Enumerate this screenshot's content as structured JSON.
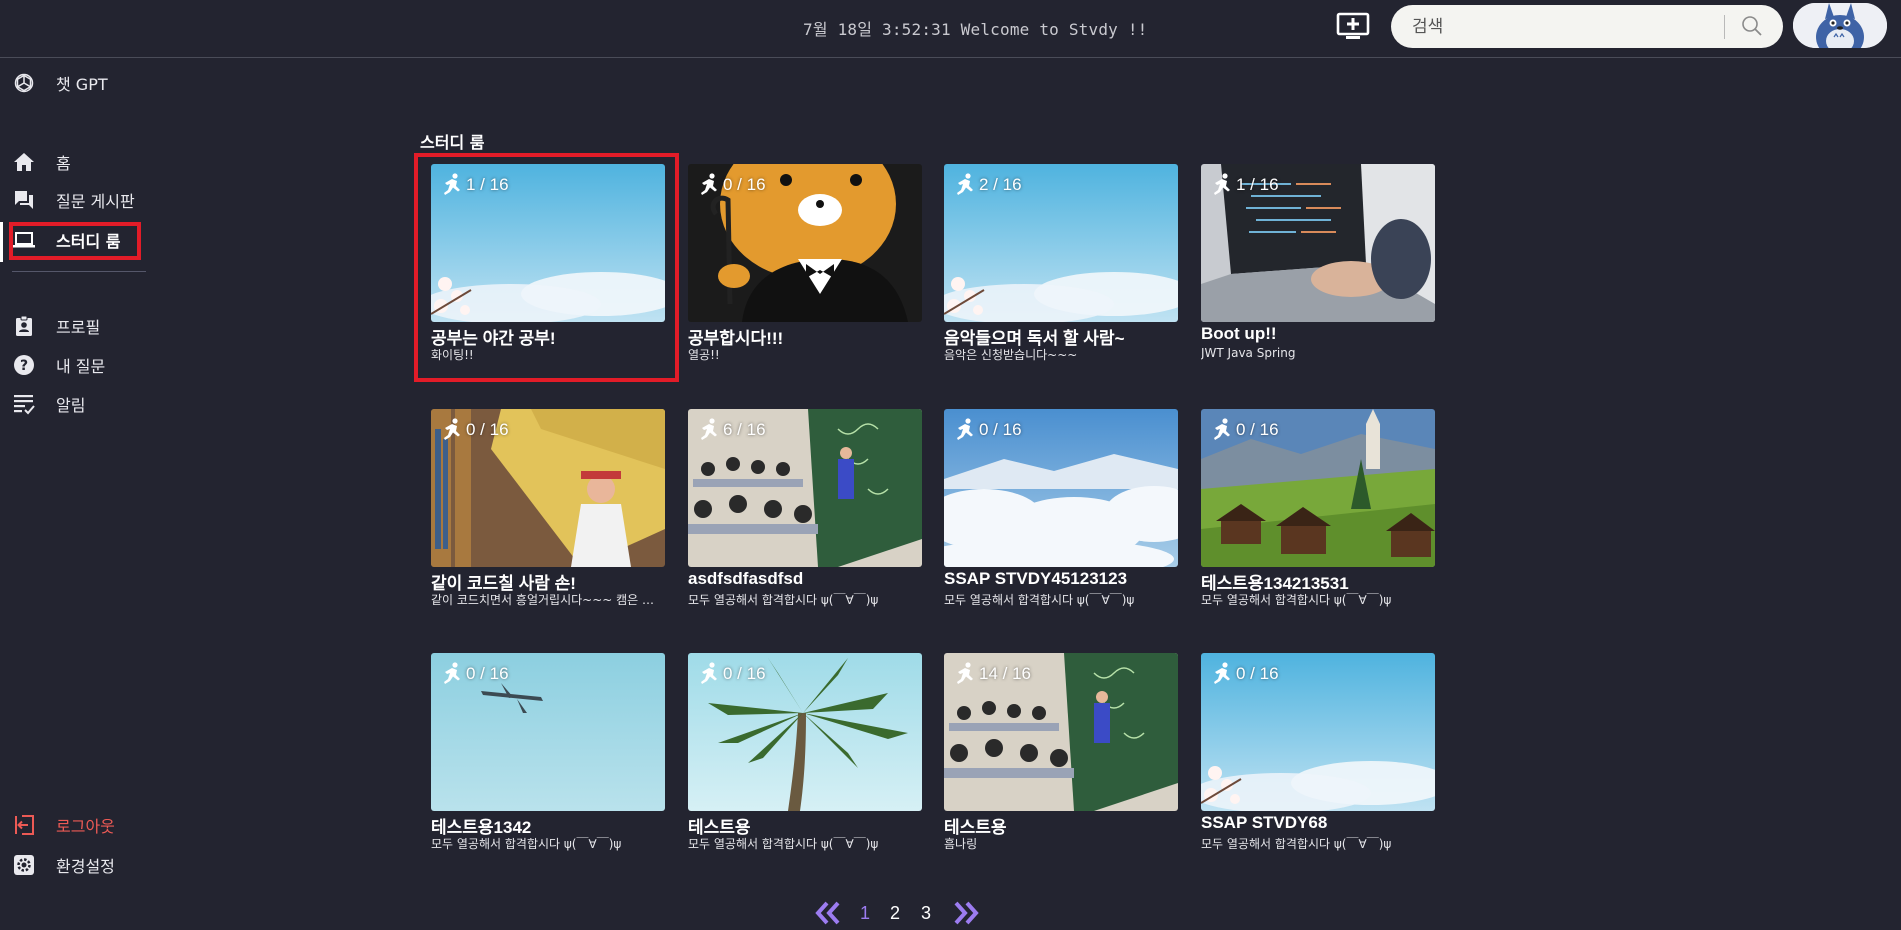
{
  "header": {
    "clock_text": "7월 18일 3:52:31 Welcome to Stvdy !!",
    "search": {
      "placeholder": "검색"
    },
    "icons": {
      "add": "add-screen-icon",
      "search": "search-icon",
      "avatar": "avatar"
    }
  },
  "sidebar": {
    "chatgpt": {
      "label": "챗 GPT",
      "icon": "openai-icon"
    },
    "nav": [
      {
        "label": "홈",
        "icon": "home-icon"
      },
      {
        "label": "질문 게시판",
        "icon": "forum-icon"
      },
      {
        "label": "스터디 룸",
        "icon": "laptop-icon",
        "active": true
      }
    ],
    "personal": [
      {
        "label": "프로필",
        "icon": "profile-icon"
      },
      {
        "label": "내 질문",
        "icon": "help-icon"
      },
      {
        "label": "알림",
        "icon": "notification-list-icon"
      }
    ],
    "bottom": [
      {
        "label": "로그아웃",
        "icon": "logout-icon",
        "color": "#ec5a55"
      },
      {
        "label": "환경설정",
        "icon": "settings-icon"
      }
    ]
  },
  "main": {
    "section_title": "스터디 룸",
    "rooms": [
      {
        "occupancy": "1 / 16",
        "title": "공부는 야간 공부!",
        "desc": "화이팅!!",
        "thumb": "sky-blossom",
        "highlighted": true
      },
      {
        "occupancy": "0 / 16",
        "title": "공부합시다!!!",
        "desc": "열공!!",
        "thumb": "ryan"
      },
      {
        "occupancy": "2 / 16",
        "title": "음악들으며 독서 할 사람~",
        "desc": "음악은 신청받습니다~~~",
        "thumb": "sky-blossom"
      },
      {
        "occupancy": "1 / 16",
        "title": "Boot up!!",
        "desc": "JWT Java Spring",
        "thumb": "laptop"
      },
      {
        "occupancy": "0 / 16",
        "title": "같이 코드칠 사람 손!",
        "desc": "같이 코드치면서 흥얼거립시다~~~ 캠은 필수!",
        "thumb": "bookstore"
      },
      {
        "occupancy": "6 / 16",
        "title": "asdfsdfasdfsd",
        "desc": "모두 열공해서 합격합시다 ψ(￣∀￣)ψ",
        "thumb": "lecture"
      },
      {
        "occupancy": "0 / 16",
        "title": "SSAP STVDY45123123",
        "desc": "모두 열공해서 합격합시다 ψ(￣∀￣)ψ",
        "thumb": "clouds"
      },
      {
        "occupancy": "0 / 16",
        "title": "테스트용134213531",
        "desc": "모두 열공해서 합격합시다 ψ(￣∀￣)ψ",
        "thumb": "alps"
      },
      {
        "occupancy": "0 / 16",
        "title": "테스트용1342",
        "desc": "모두 열공해서 합격합시다 ψ(￣∀￣)ψ",
        "thumb": "plane"
      },
      {
        "occupancy": "0 / 16",
        "title": "테스트용",
        "desc": "모두 열공해서 합격합시다 ψ(￣∀￣)ψ",
        "thumb": "palm"
      },
      {
        "occupancy": "14 / 16",
        "title": "테스트용",
        "desc": "흠나링",
        "thumb": "lecture"
      },
      {
        "occupancy": "0 / 16",
        "title": "SSAP STVDY68",
        "desc": "모두 열공해서 합격합시다 ψ(￣∀￣)ψ",
        "thumb": "sky-blossom"
      }
    ]
  },
  "pagination": {
    "pages": [
      "1",
      "2",
      "3"
    ],
    "current": "1",
    "accent": "#9c7cf0",
    "icons": {
      "prev": "double-chevron-left-icon",
      "next": "double-chevron-right-icon"
    }
  },
  "colors": {
    "background": "#232430",
    "highlight": "#e21c28",
    "logout": "#ec5a55"
  }
}
